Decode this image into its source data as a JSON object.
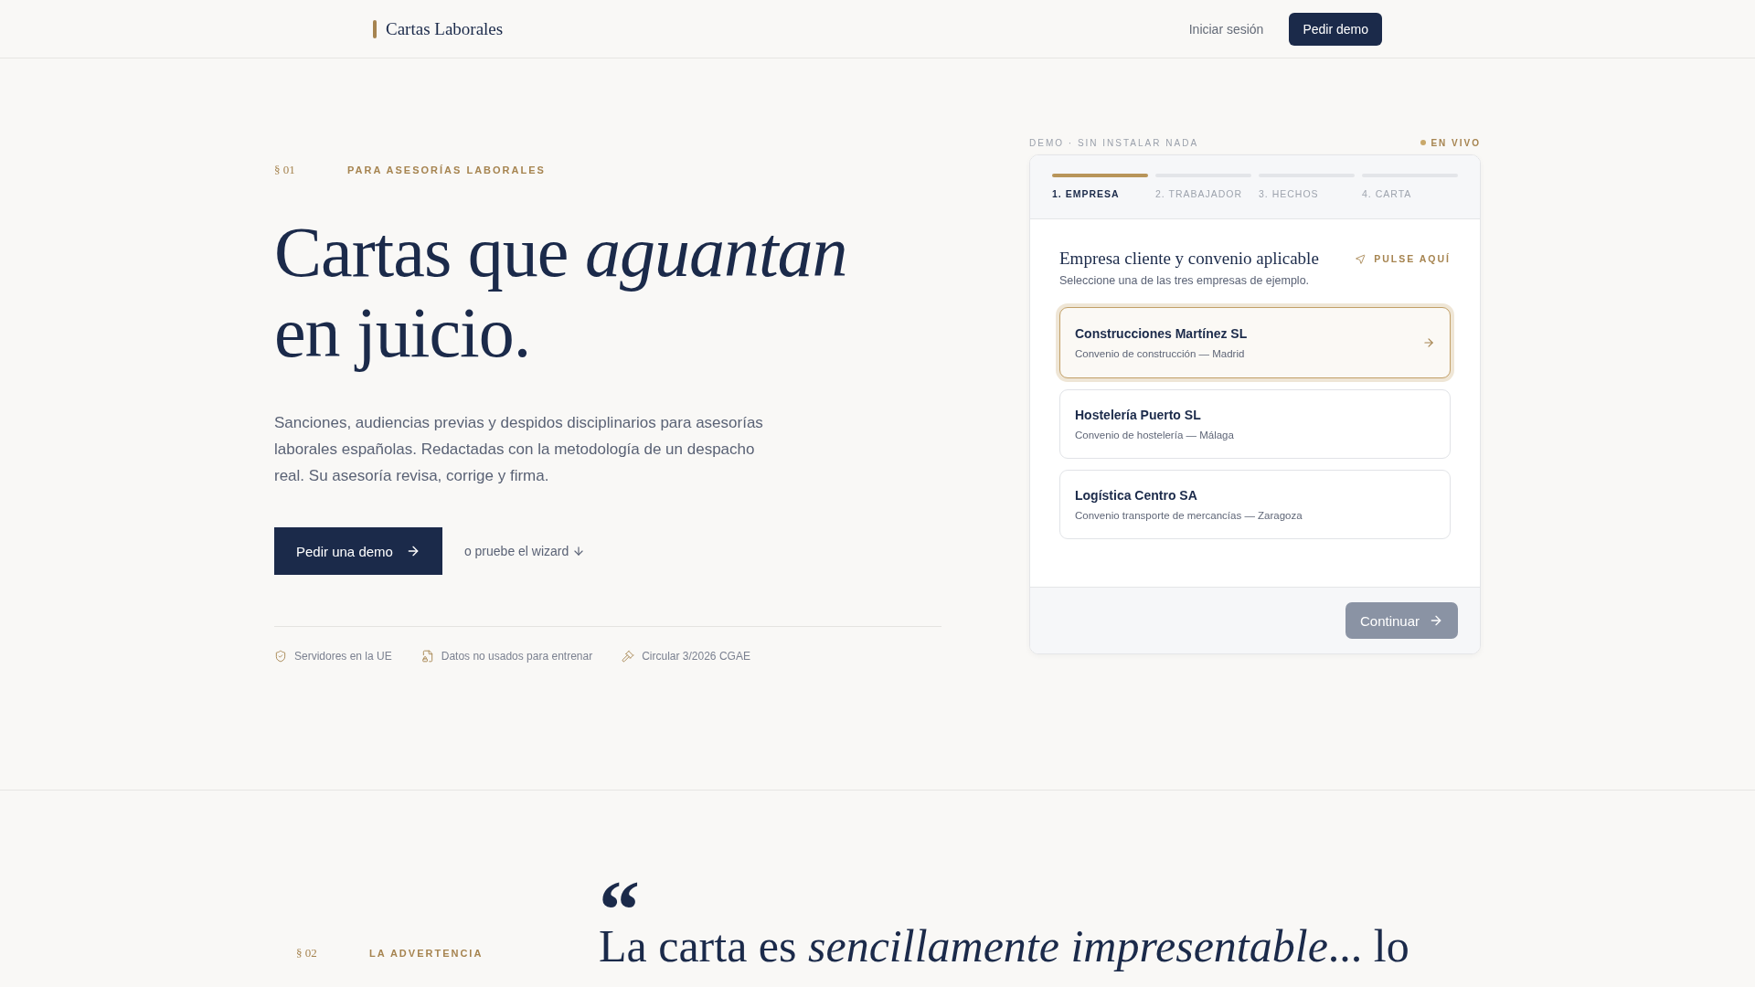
{
  "header": {
    "logo": "Cartas Laborales",
    "login": "Iniciar sesión",
    "cta": "Pedir demo"
  },
  "hero": {
    "section_number": "§ 01",
    "eyebrow": "PARA ASESORÍAS LABORALES",
    "title_line_1": "Cartas que *aguantan*",
    "title_line_2": "en juicio.",
    "lead": "Sanciones, audiencias previas y despidos disciplinarios para asesorías laborales españolas. Redactadas con la metodología de un despacho real. Su asesoría revisa, corrige y firma.",
    "primary_button": "Pedir una demo",
    "secondary_link": "o pruebe el wizard",
    "trust": [
      {
        "kind": "shield",
        "text": "Servidores en la UE"
      },
      {
        "kind": "file",
        "text": "Datos no usados para entrenar"
      },
      {
        "kind": "gavel",
        "text": "Circular 3/2026 CGAE"
      }
    ]
  },
  "demo": {
    "label": "DEMO · SIN INSTALAR NADA",
    "live": "EN VIVO",
    "steps": [
      {
        "label": "1. EMPRESA",
        "selected": true
      },
      {
        "label": "2. TRABAJADOR",
        "selected": false
      },
      {
        "label": "3. HECHOS",
        "selected": false
      },
      {
        "label": "4. CARTA",
        "selected": false
      }
    ],
    "title": "Empresa cliente y convenio aplicable",
    "hint": "PULSE AQUÍ",
    "subtitle": "Seleccione una de las tres empresas de ejemplo.",
    "companies": [
      {
        "name": "Construcciones Martínez SL",
        "detail": "Convenio de construcción — Madrid",
        "selected": true
      },
      {
        "name": "Hostelería Puerto SL",
        "detail": "Convenio de hostelería — Málaga",
        "selected": false
      },
      {
        "name": "Logística Centro SA",
        "detail": "Convenio transporte de mercancías — Zaragoza",
        "selected": false
      }
    ],
    "continue_button": {
      "label": "Continuar",
      "disabled": true
    }
  },
  "warning": {
    "section_number": "§ 02",
    "eyebrow": "LA ADVERTENCIA",
    "quote_mark": "“",
    "quote": "La carta es *sencillamente impresentable*... lo"
  }
}
